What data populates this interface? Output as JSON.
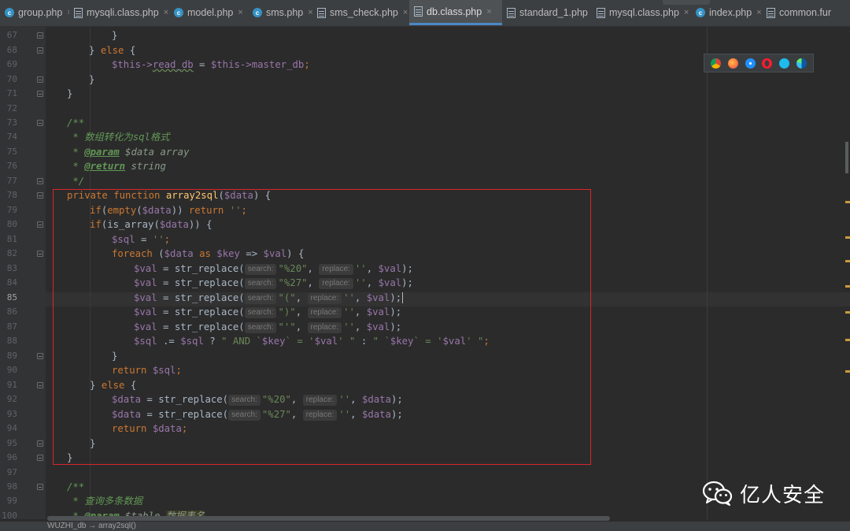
{
  "tabs": [
    {
      "label": "group.php",
      "icon": "php-class-icon",
      "active": false
    },
    {
      "label": "mysqli.class.php",
      "icon": "php-file-icon",
      "active": false
    },
    {
      "label": "model.php",
      "icon": "php-class-icon",
      "active": false
    },
    {
      "label": "sms.php",
      "icon": "php-class-icon",
      "active": false
    },
    {
      "label": "sms_check.php",
      "icon": "php-file-icon",
      "active": false
    },
    {
      "label": "db.class.php",
      "icon": "php-file-icon",
      "active": true
    },
    {
      "label": "standard_1.php",
      "icon": "php-file-icon",
      "active": false
    },
    {
      "label": "mysql.class.php",
      "icon": "php-file-icon",
      "active": false
    },
    {
      "label": "index.php",
      "icon": "php-class-icon",
      "active": false
    },
    {
      "label": "common.fur",
      "icon": "php-file-icon",
      "active": false
    }
  ],
  "editor": {
    "current_line": "85",
    "line_numbers": [
      "67",
      "68",
      "69",
      "70",
      "71",
      "72",
      "73",
      "74",
      "75",
      "76",
      "77",
      "78",
      "79",
      "80",
      "81",
      "82",
      "83",
      "84",
      "85",
      "86",
      "87",
      "88",
      "89",
      "90",
      "91",
      "92",
      "93",
      "94",
      "95",
      "96",
      "97",
      "98",
      "99",
      "100"
    ],
    "hints": {
      "search": "search:",
      "replace": "replace:"
    },
    "code": {
      "l67_close": "}",
      "l68_else": "} else {",
      "l69_a": "$this->",
      "l69_b": "read_db",
      "l69_c": " = ",
      "l69_d": "$this->",
      "l69_e": "master_db",
      "l69_f": ";",
      "l70": "}",
      "l71": "}",
      "l73": "/**",
      "l74": " * 数组转化为sql格式",
      "l75_star": " * ",
      "l75_tag": "@param",
      "l75_rest": " $data array",
      "l76_star": " * ",
      "l76_tag": "@return",
      "l76_rest": " string",
      "l77": " */",
      "l78_kw": "private function ",
      "l78_fn": "array2sql",
      "l78_p1": "(",
      "l78_var": "$data",
      "l78_p2": ") {",
      "l79_kw": "if",
      "l79_a": "(",
      "l79_kw2": "empty",
      "l79_b": "(",
      "l79_var": "$data",
      "l79_c": ")) ",
      "l79_kw3": "return ",
      "l79_str": "''",
      "l79_d": ";",
      "l80_kw": "if",
      "l80_a": "(is_array(",
      "l80_var": "$data",
      "l80_b": ")) {",
      "l81_var": "$sql",
      "l81_a": " = ",
      "l81_str": "''",
      "l81_b": ";",
      "l82_kw": "foreach ",
      "l82_a": "(",
      "l82_v1": "$data",
      "l82_kw2": " as ",
      "l82_v2": "$key",
      "l82_b": " => ",
      "l82_v3": "$val",
      "l82_c": ") {",
      "val": "$val",
      "data_var": "$data",
      "assign_replace": " = str_replace(",
      "s20": "\"%20\"",
      "s27": "\"%27\"",
      "sparen": "\"(\"",
      "srparen": "\")\"",
      "squote": "\"'\"",
      "empty_str": "''",
      "comma": ", ",
      "endp": ");",
      "l88_var": "$sql",
      "l88_a": " .= ",
      "l88_var2": "$sql",
      "l88_b": " ? ",
      "l88_str1": "\" AND `",
      "l88_v1": "$key",
      "l88_str2": "` = '",
      "l88_v2": "$val",
      "l88_str3": "' \"",
      "l88_c": " : ",
      "l88_str4": "\" `",
      "l88_v3": "$key",
      "l88_str5": "` = '",
      "l88_v4": "$val",
      "l88_str6": "' \"",
      "l88_d": ";",
      "l89": "}",
      "l90_kw": "return ",
      "l90_var": "$sql",
      "l90_a": ";",
      "l91_a": "} ",
      "l91_kw": "else",
      "l91_b": " {",
      "l94_kw": "return ",
      "l94_var": "$data",
      "l94_a": ";",
      "l95": "}",
      "l96": "}",
      "l98": "/**",
      "l99": " * 查询多条数据",
      "l100_star": " * ",
      "l100_tag": "@param",
      "l100_rest": " $table ",
      "l100_cn": "数据表名"
    }
  },
  "browser_icons": [
    "chrome-icon",
    "firefox-icon",
    "safari-icon",
    "opera-icon",
    "ie-icon",
    "edge-icon"
  ],
  "status_bar": {
    "breadcrumb": "WUZHI_db → array2sql()"
  },
  "watermark": {
    "text": "亿人安全",
    "logo": "wechat-logo"
  },
  "colors": {
    "highlight_box": "#d9262c",
    "keyword": "#cc7832",
    "variable": "#9876aa",
    "string": "#6a8759",
    "function": "#ffc66d"
  }
}
